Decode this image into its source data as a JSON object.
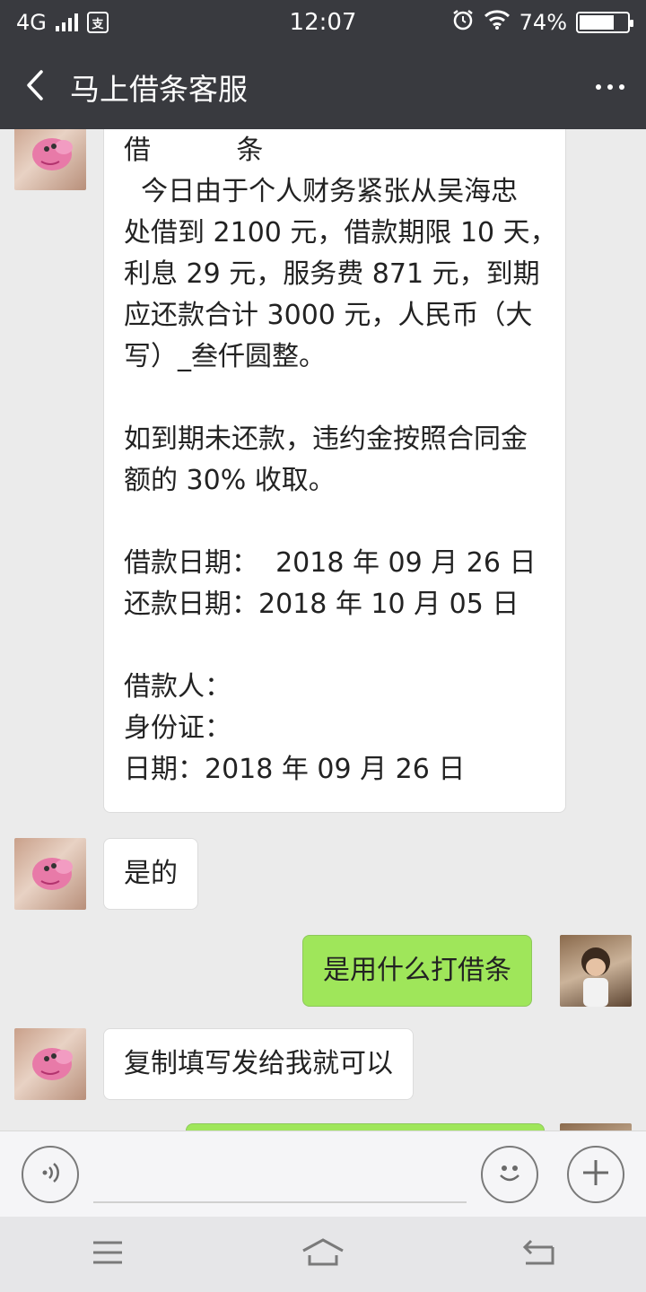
{
  "status_bar": {
    "network": "4G",
    "time": "12:07",
    "battery": "74%",
    "battery_level": 0.74
  },
  "header": {
    "title": "马上借条客服"
  },
  "messages": [
    {
      "side": "left",
      "lines": [
        "借          条",
        "  今日由于个人财务紧张从吴海忠",
        "处借到 2100 元，借款期限 10 天，",
        "利息 29 元，服务费 871 元，到期",
        "应还款合计 3000 元，人民币（大",
        "写）_叁仟圆整。",
        "",
        "如到期未还款，违约金按照合同金",
        "额的 30% 收取。",
        "",
        "借款日期：  2018 年 09 月 26 日",
        "还款日期：2018 年 10 月 05 日",
        "",
        "借款人：",
        "身份证：",
        "日期：2018 年 09 月 26 日"
      ]
    },
    {
      "side": "left",
      "text": "是的"
    },
    {
      "side": "right",
      "text": "是用什么打借条"
    },
    {
      "side": "left",
      "text": "复制填写发给我就可以"
    }
  ],
  "icons": {
    "back": "chevron-left-icon",
    "more": "more-dots-icon",
    "voice": "voice-icon",
    "emoji": "emoji-icon",
    "add": "plus-icon",
    "menu": "menu-icon",
    "home": "home-icon",
    "return": "return-icon"
  },
  "colors": {
    "header_bg": "#393a3f",
    "chat_bg": "#ebebeb",
    "sent_bubble": "#9fe65a",
    "received_bubble": "#ffffff"
  }
}
